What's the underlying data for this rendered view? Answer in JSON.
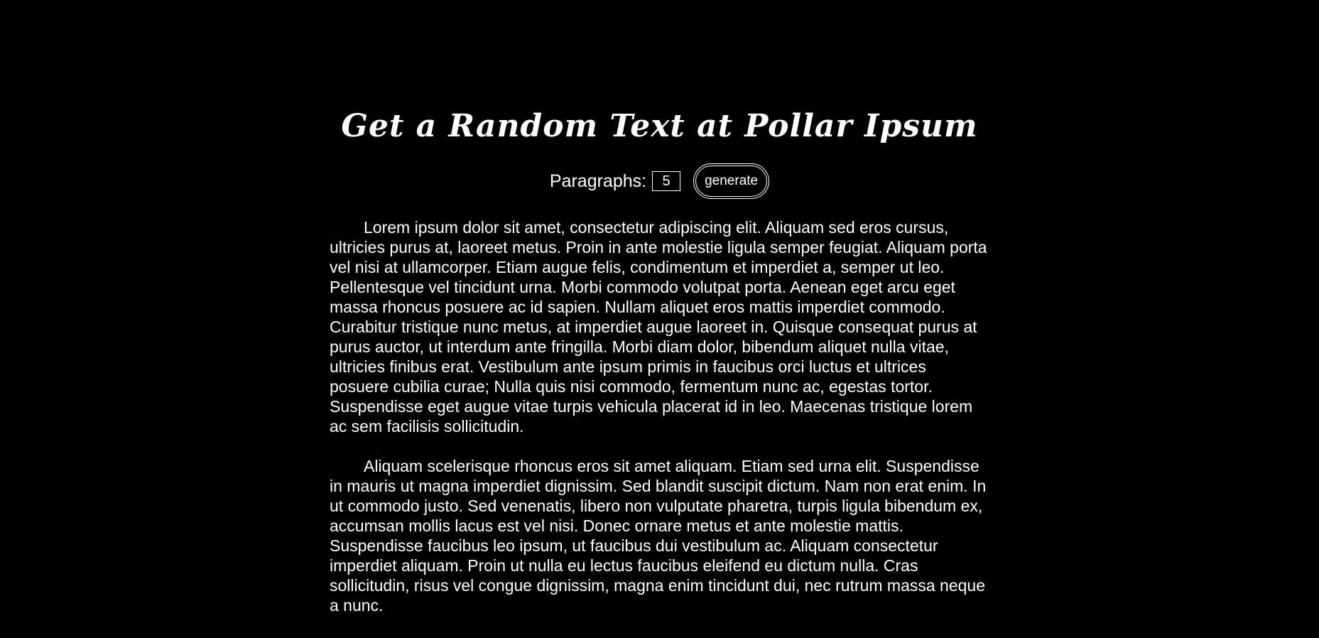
{
  "header": {
    "title": "Get a Random Text at Pollar Ipsum"
  },
  "controls": {
    "paragraphs_label": "Paragraphs:",
    "paragraphs_value": "5",
    "generate_label": "generate"
  },
  "paragraphs": [
    "Lorem ipsum dolor sit amet, consectetur adipiscing elit. Aliquam sed eros cursus, ultricies purus at, laoreet metus. Proin in ante molestie ligula semper feugiat. Aliquam porta vel nisi at ullamcorper. Etiam augue felis, condimentum et imperdiet a, semper ut leo. Pellentesque vel tincidunt urna. Morbi commodo volutpat porta. Aenean eget arcu eget massa rhoncus posuere ac id sapien. Nullam aliquet eros mattis imperdiet commodo. Curabitur tristique nunc metus, at imperdiet augue laoreet in. Quisque consequat purus at purus auctor, ut interdum ante fringilla. Morbi diam dolor, bibendum aliquet nulla vitae, ultricies finibus erat. Vestibulum ante ipsum primis in faucibus orci luctus et ultrices posuere cubilia curae; Nulla quis nisi commodo, fermentum nunc ac, egestas tortor. Suspendisse eget augue vitae turpis vehicula placerat id in leo. Maecenas tristique lorem ac sem facilisis sollicitudin.",
    "Aliquam scelerisque rhoncus eros sit amet aliquam. Etiam sed urna elit. Suspendisse in mauris ut magna imperdiet dignissim. Sed blandit suscipit dictum. Nam non erat enim. In ut commodo justo. Sed venenatis, libero non vulputate pharetra, turpis ligula bibendum ex, accumsan mollis lacus est vel nisi. Donec ornare metus et ante molestie mattis. Suspendisse faucibus leo ipsum, ut faucibus dui vestibulum ac. Aliquam consectetur imperdiet aliquam. Proin ut nulla eu lectus faucibus eleifend eu dictum nulla. Cras sollicitudin, risus vel congue dignissim, magna enim tincidunt dui, nec rutrum massa neque a nunc."
  ],
  "colors": {
    "background": "#000000",
    "text": "#ffffff"
  }
}
